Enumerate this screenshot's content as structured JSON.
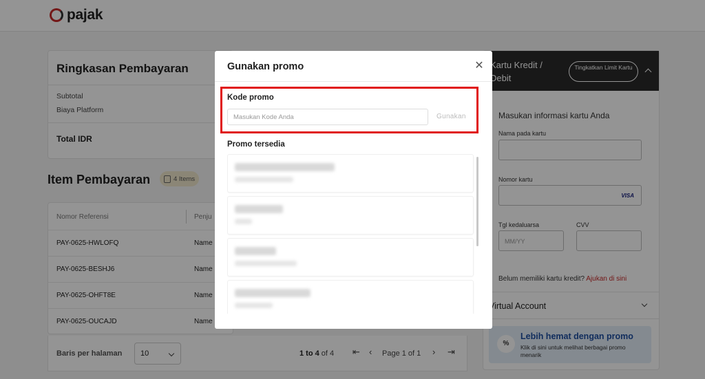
{
  "brand": {
    "name": "pajak"
  },
  "summary": {
    "title": "Ringkasan Pembayaran",
    "rows": [
      "Subtotal",
      "Biaya Platform"
    ],
    "total_label": "Total IDR"
  },
  "items": {
    "title": "Item Pembayaran",
    "badge": "4 Items",
    "columns": [
      "Nomor Referensi",
      "Penju"
    ],
    "rows": [
      {
        "ref": "PAY-0625-HWLOFQ",
        "name": "Name"
      },
      {
        "ref": "PAY-0625-BESHJ6",
        "name": "Name"
      },
      {
        "ref": "PAY-0625-OHFT8E",
        "name": "Name"
      },
      {
        "ref": "PAY-0625-OUCAJD",
        "name": "Name"
      }
    ]
  },
  "pager": {
    "rows_label": "Baris per halaman",
    "rows_value": "10",
    "range_prefix": "1 to 4",
    "range_suffix": " of 4",
    "page": "Page 1 of 1"
  },
  "card_panel": {
    "title": "Kartu Kredit / Debit",
    "upgrade": "Tingkatkan Limit Kartu",
    "subtitle": "Masukan informasi kartu Anda",
    "name_label": "Nama pada kartu",
    "number_label": "Nomor kartu",
    "card_brand": "VISA",
    "expiry_label": "Tgl kedaluarsa",
    "expiry_placeholder": "MM/YY",
    "cvv_label": "CVV",
    "note": "Belum memiliki kartu kredit? ",
    "note_link": "Ajukan di sini",
    "va_title": "Virtual Account",
    "promo_title": "Lebih hemat dengan promo",
    "promo_desc": "Klik di sini untuk melihat berbagai promo menarik",
    "promo_icon": "%"
  },
  "modal": {
    "title": "Gunakan promo",
    "code_label": "Kode promo",
    "code_placeholder": "Masukan Kode Anda",
    "apply": "Gunakan",
    "available_label": "Promo tersedia"
  },
  "colors": {
    "brand_red": "#c62828",
    "highlight": "#e01414",
    "promo_blue": "#1e4fa1"
  }
}
